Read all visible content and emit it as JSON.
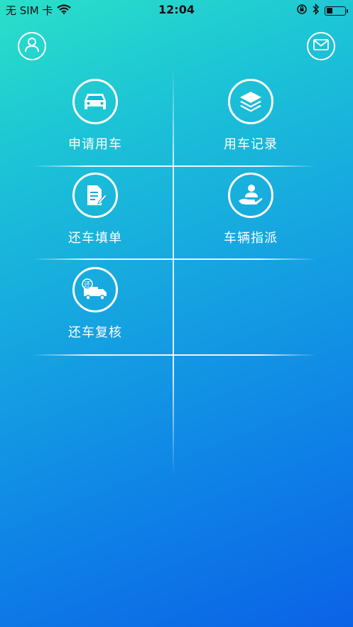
{
  "status_bar": {
    "carrier": "无 SIM 卡",
    "time": "12:04",
    "battery_level": 0.35
  },
  "header": {
    "profile_icon": "user-icon",
    "mail_icon": "mail-icon"
  },
  "menu": [
    {
      "label": "申请用车",
      "icon": "car-icon"
    },
    {
      "label": "用车记录",
      "icon": "layers-icon"
    },
    {
      "label": "还车填单",
      "icon": "form-edit-icon"
    },
    {
      "label": "车辆指派",
      "icon": "hand-person-icon"
    },
    {
      "label": "还车复核",
      "icon": "truck-return-icon",
      "badge": "还"
    }
  ]
}
